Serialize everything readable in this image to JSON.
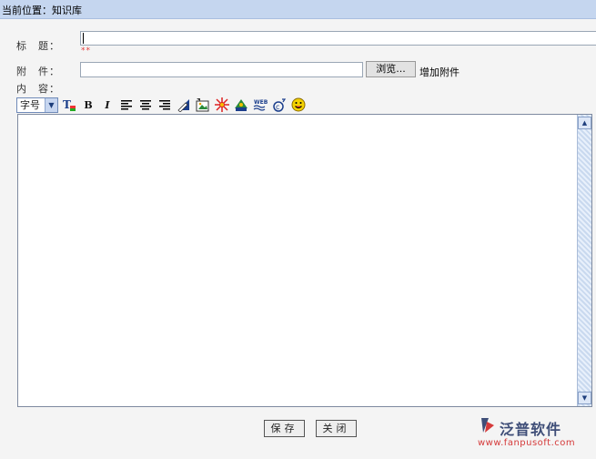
{
  "breadcrumb": "当前位置：知识库",
  "form": {
    "title_label": "标　题：",
    "required_mark": "**",
    "attachment_label": "附　件：",
    "browse_label": "浏览...",
    "add_attachment": "增加附件",
    "content_label": "内　容："
  },
  "toolbar": {
    "font_size": "字号",
    "dropdown_arrow": "▼",
    "buttons": [
      {
        "name": "text-color-icon",
        "glyph": "T"
      },
      {
        "name": "bold-icon",
        "glyph": "B"
      },
      {
        "name": "italic-icon",
        "glyph": "I"
      },
      {
        "name": "align-left-icon",
        "glyph": "≡"
      },
      {
        "name": "align-center-icon",
        "glyph": "≡"
      },
      {
        "name": "align-right-icon",
        "glyph": "≡"
      },
      {
        "name": "edit-pencil-icon",
        "glyph": "✎"
      },
      {
        "name": "insert-image-icon",
        "glyph": "▣"
      },
      {
        "name": "flash-icon",
        "glyph": "✹"
      },
      {
        "name": "media-icon",
        "glyph": "▲"
      },
      {
        "name": "web-icon",
        "glyph": "W"
      },
      {
        "name": "special-char-icon",
        "glyph": "©"
      },
      {
        "name": "emoticon-icon",
        "glyph": "☺"
      }
    ]
  },
  "scroll": {
    "up": "▲",
    "down": "▼"
  },
  "actions": {
    "save": "保存",
    "close": "关闭"
  },
  "logo": {
    "name": "泛普软件",
    "url": "www.fanpusoft.com"
  },
  "colors": {
    "accent": "#c5d6ef",
    "required": "#e23b3b",
    "logo_text": "#3f4e78",
    "logo_url": "#d53a3a"
  }
}
